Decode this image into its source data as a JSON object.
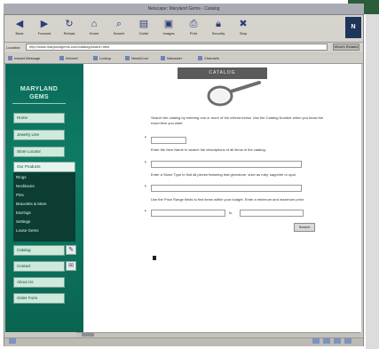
{
  "window": {
    "title": "Netscape: Maryland Gems - Catalog"
  },
  "toolbar": {
    "buttons": [
      {
        "label": "Back",
        "icon": "back-arrow-icon"
      },
      {
        "label": "Forward",
        "icon": "forward-arrow-icon"
      },
      {
        "label": "Reload",
        "icon": "reload-icon"
      },
      {
        "label": "Home",
        "icon": "home-icon"
      },
      {
        "label": "Search",
        "icon": "search-icon"
      },
      {
        "label": "Guide",
        "icon": "guide-icon"
      },
      {
        "label": "Images",
        "icon": "images-icon"
      },
      {
        "label": "Print",
        "icon": "print-icon"
      },
      {
        "label": "Security",
        "icon": "security-icon"
      },
      {
        "label": "Stop",
        "icon": "stop-icon"
      }
    ],
    "brand": "N"
  },
  "location": {
    "label": "Location:",
    "value": "http://www.marylandgems.com/catalog/search.html",
    "button": "What's Related"
  },
  "personal_toolbar": {
    "items": [
      "Instant Message",
      "Internet",
      "Lookup",
      "New&Cool",
      "Netcaster",
      "Channels"
    ]
  },
  "sidebar": {
    "logo_line1": "MARYLAND",
    "logo_line2": "GEMS",
    "nav": [
      "Home",
      "Jewelry Line",
      "Store Locator",
      "Our Products"
    ],
    "submenu": [
      "Rings",
      "Necklaces",
      "Pins",
      "Bracelets & More",
      "Earrings",
      "Settings",
      "Loose Gems"
    ],
    "bottom_nav": [
      "Catalog",
      "Contact",
      "About Us",
      "Order Form"
    ]
  },
  "main": {
    "banner": "CATALOG",
    "intro": "Search the catalog by entering one or more of the criteria below. Use the Catalog Number when you know the exact item you want.",
    "criteria": [
      {
        "text": "Enter the Item Name to search the descriptions of all items in the catalog."
      },
      {
        "text": "Enter a Stone Type to find all pieces featuring that gemstone, such as ruby, sapphire or opal."
      },
      {
        "text": "Use the Price Range fields to find items within your budget. Enter a minimum and maximum price."
      }
    ],
    "to_label": "to",
    "submit": "Search"
  }
}
